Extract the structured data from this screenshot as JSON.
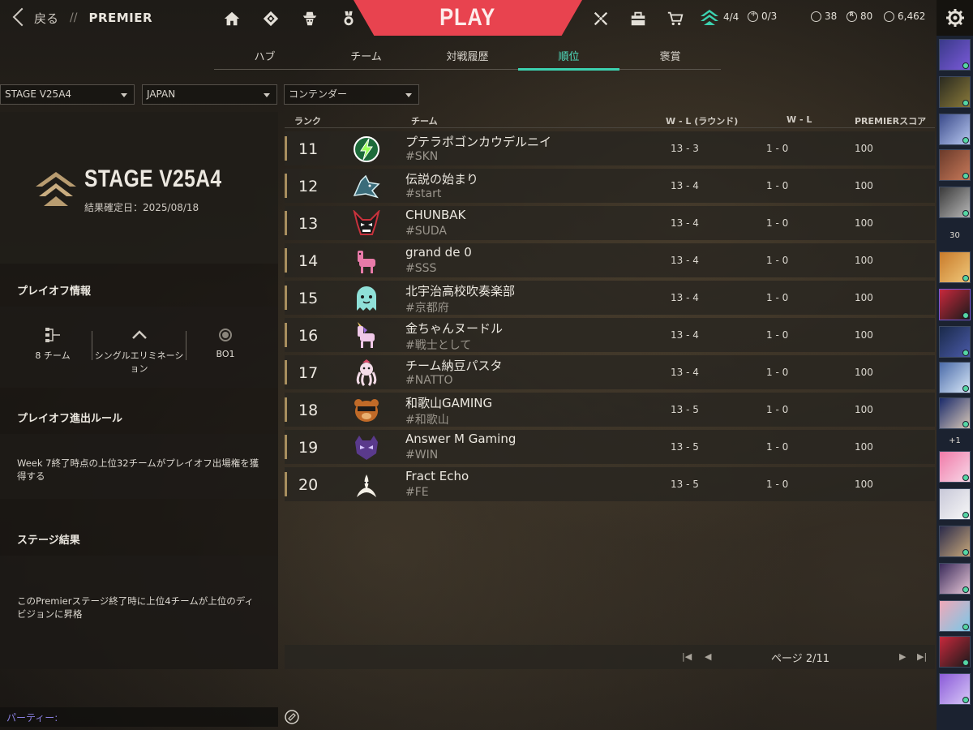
{
  "topbar": {
    "back_label": "戻る",
    "crumb_sep": "//",
    "crumb": "PREMIER",
    "play_label": "PLAY",
    "nav_icons": [
      "home-icon",
      "collection-icon",
      "agents-icon",
      "career-icon"
    ],
    "right_icons": [
      "battlepass-icon",
      "store-bag-icon",
      "cart-icon"
    ],
    "premier_progress": "4/4",
    "free_agent_count": "0/3",
    "vp": "38",
    "radianite": "80",
    "kingdom_credits": "6,462"
  },
  "subtabs": [
    "ハブ",
    "チーム",
    "対戦履歴",
    "順位",
    "褒賞"
  ],
  "active_subtab": 3,
  "filters": {
    "stage": "STAGE V25A4",
    "region": "JAPAN",
    "division": "コンテンダー"
  },
  "stage": {
    "title": "STAGE V25A4",
    "date": "結果確定日：2025/08/18"
  },
  "playoff": {
    "heading": "プレイオフ情報",
    "teams": "8 チーム",
    "format": "シングルエリミネーション",
    "series": "BO1"
  },
  "qualify": {
    "heading": "プレイオフ進出ルール",
    "text": "Week 7終了時点の上位32チームがプレイオフ出場権を獲得する"
  },
  "results": {
    "heading": "ステージ結果",
    "text": "このPremierステージ終了時に上位4チームが上位のディビジョンに昇格"
  },
  "table": {
    "headers": {
      "rank": "ランク",
      "team": "チーム",
      "rounds": "W - L (ラウンド)",
      "wl": "W - L",
      "score": "PREMIERスコア"
    },
    "rows": [
      {
        "rank": "11",
        "name": "プテラポゴンカウデルニイ",
        "tag": "#SKN",
        "rounds": "13 - 3",
        "wl": "1 - 0",
        "score": "100",
        "logo": "lightning-emblem"
      },
      {
        "rank": "12",
        "name": "伝説の始まり",
        "tag": "#start",
        "rounds": "13 - 4",
        "wl": "1 - 0",
        "score": "100",
        "logo": "shark-emblem"
      },
      {
        "rank": "13",
        "name": "CHUNBAK",
        "tag": "#SUDA",
        "rounds": "13 - 4",
        "wl": "1 - 0",
        "score": "100",
        "logo": "demon-mask-emblem"
      },
      {
        "rank": "14",
        "name": "grand de 0",
        "tag": "#SSS",
        "rounds": "13 - 4",
        "wl": "1 - 0",
        "score": "100",
        "logo": "pink-llama-emblem"
      },
      {
        "rank": "15",
        "name": "北宇治高校吹奏楽部",
        "tag": "#京都府",
        "rounds": "13 - 4",
        "wl": "1 - 0",
        "score": "100",
        "logo": "ghost-emblem"
      },
      {
        "rank": "16",
        "name": "金ちゃんヌードル",
        "tag": "#戦士として",
        "rounds": "13 - 4",
        "wl": "1 - 0",
        "score": "100",
        "logo": "unicorn-emblem"
      },
      {
        "rank": "17",
        "name": "チーム納豆パスタ",
        "tag": "#NATTO",
        "rounds": "13 - 4",
        "wl": "1 - 0",
        "score": "100",
        "logo": "octopus-emblem"
      },
      {
        "rank": "18",
        "name": "和歌山GAMING",
        "tag": "#和歌山",
        "rounds": "13 - 5",
        "wl": "1 - 0",
        "score": "100",
        "logo": "bear-emblem"
      },
      {
        "rank": "19",
        "name": "Answer M Gaming",
        "tag": "#WIN",
        "rounds": "13 - 5",
        "wl": "1 - 0",
        "score": "100",
        "logo": "purple-skull-emblem"
      },
      {
        "rank": "20",
        "name": "Fract Echo",
        "tag": "#FE",
        "rounds": "13 - 5",
        "wl": "1 - 0",
        "score": "100",
        "logo": "banana-emblem"
      }
    ]
  },
  "pager": {
    "label": "ページ 2/11"
  },
  "party": {
    "placeholder": "パーティー:"
  },
  "rail": {
    "count_badge": "30",
    "plus_badge": "+1"
  },
  "colors": {
    "accent": "#3cd2b0",
    "play": "#e8434f",
    "rank_bar": "#a88e5e",
    "online": "#56d7a4"
  }
}
